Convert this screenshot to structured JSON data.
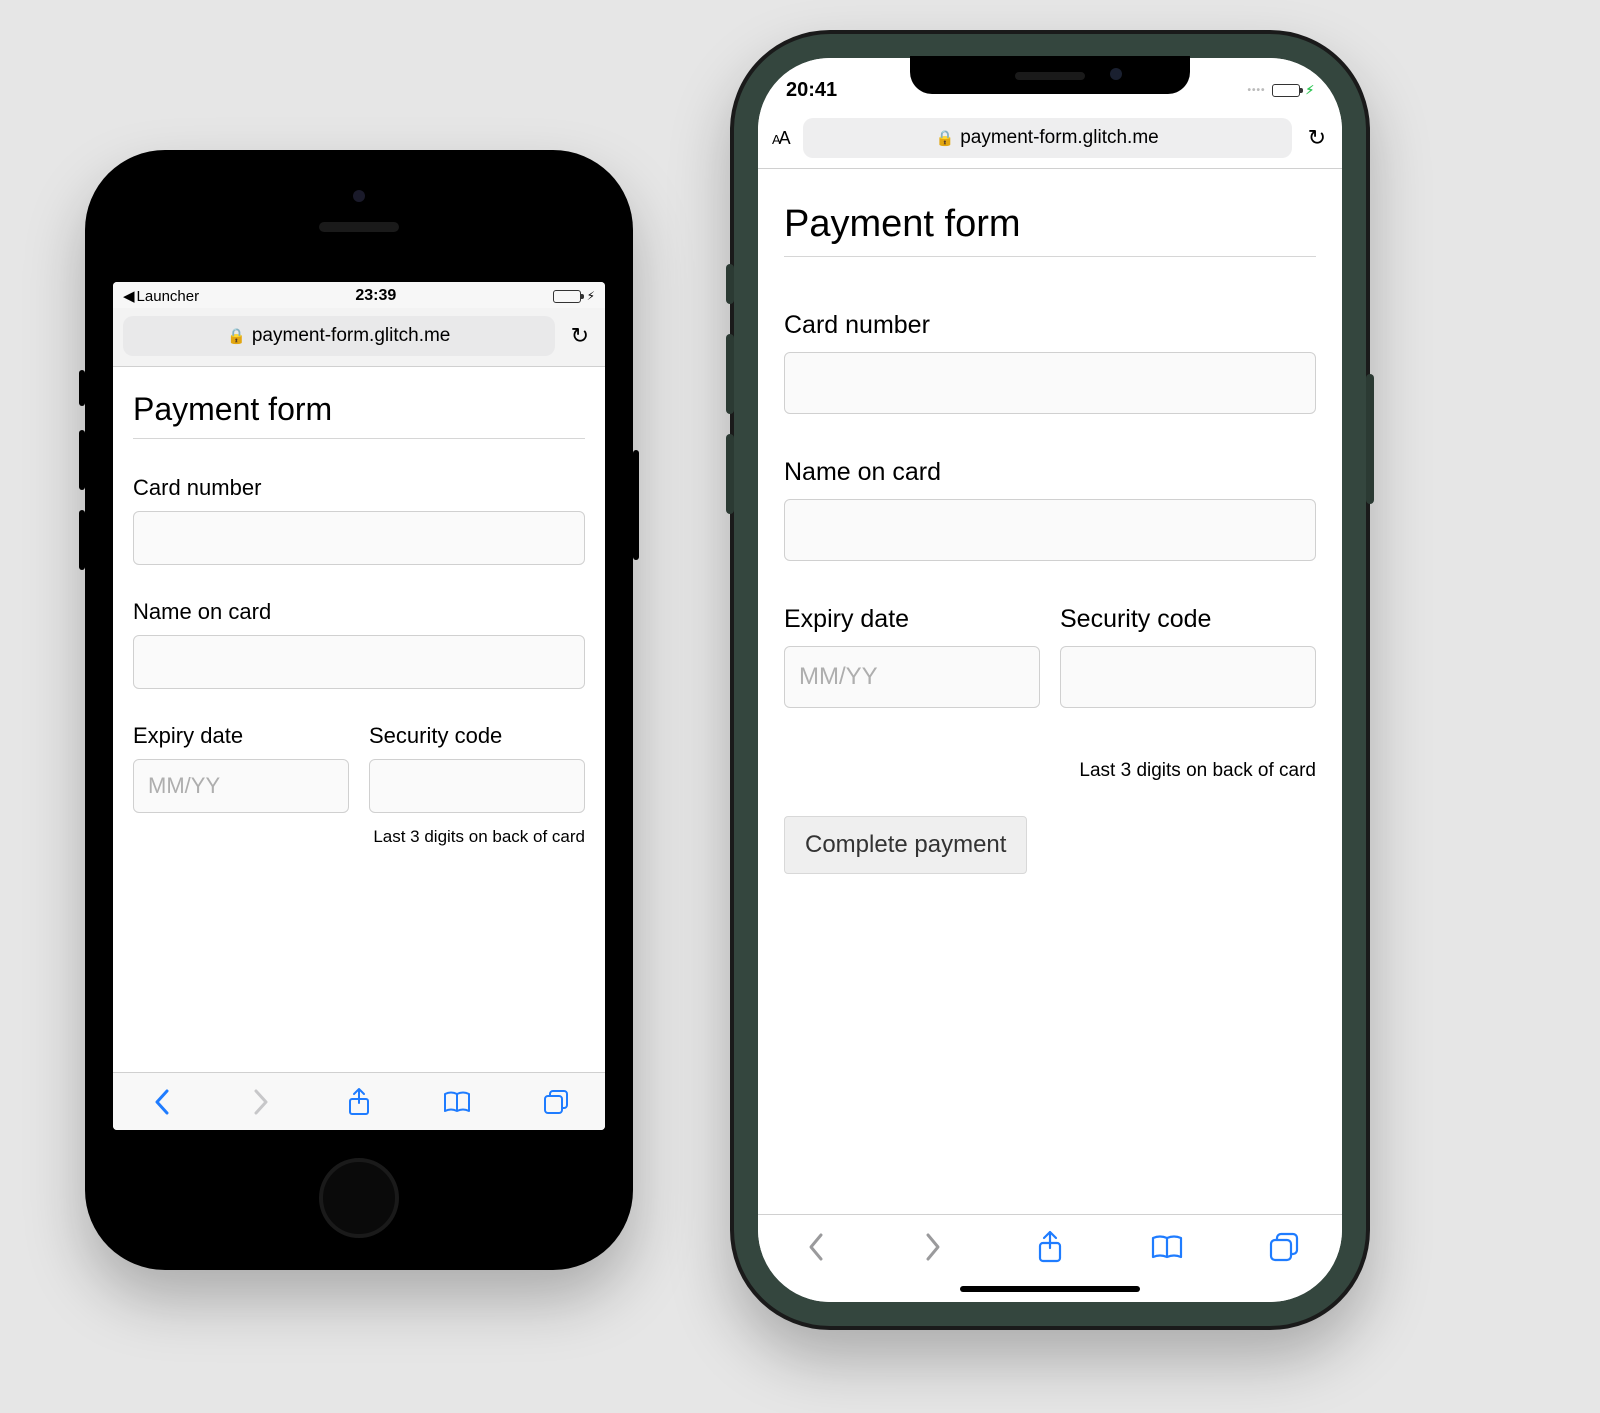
{
  "phone_left": {
    "status": {
      "back_app": "Launcher",
      "time": "23:39"
    },
    "url": "payment-form.glitch.me",
    "page": {
      "title": "Payment form",
      "card_number_label": "Card number",
      "name_label": "Name on card",
      "expiry_label": "Expiry date",
      "expiry_placeholder": "MM/YY",
      "cvc_label": "Security code",
      "cvc_hint": "Last 3 digits on back of card"
    }
  },
  "phone_right": {
    "status": {
      "time": "20:41"
    },
    "url": "payment-form.glitch.me",
    "aa_label": "AA",
    "page": {
      "title": "Payment form",
      "card_number_label": "Card number",
      "name_label": "Name on card",
      "expiry_label": "Expiry date",
      "expiry_placeholder": "MM/YY",
      "cvc_label": "Security code",
      "cvc_hint": "Last 3 digits on back of card",
      "submit_label": "Complete payment"
    }
  }
}
